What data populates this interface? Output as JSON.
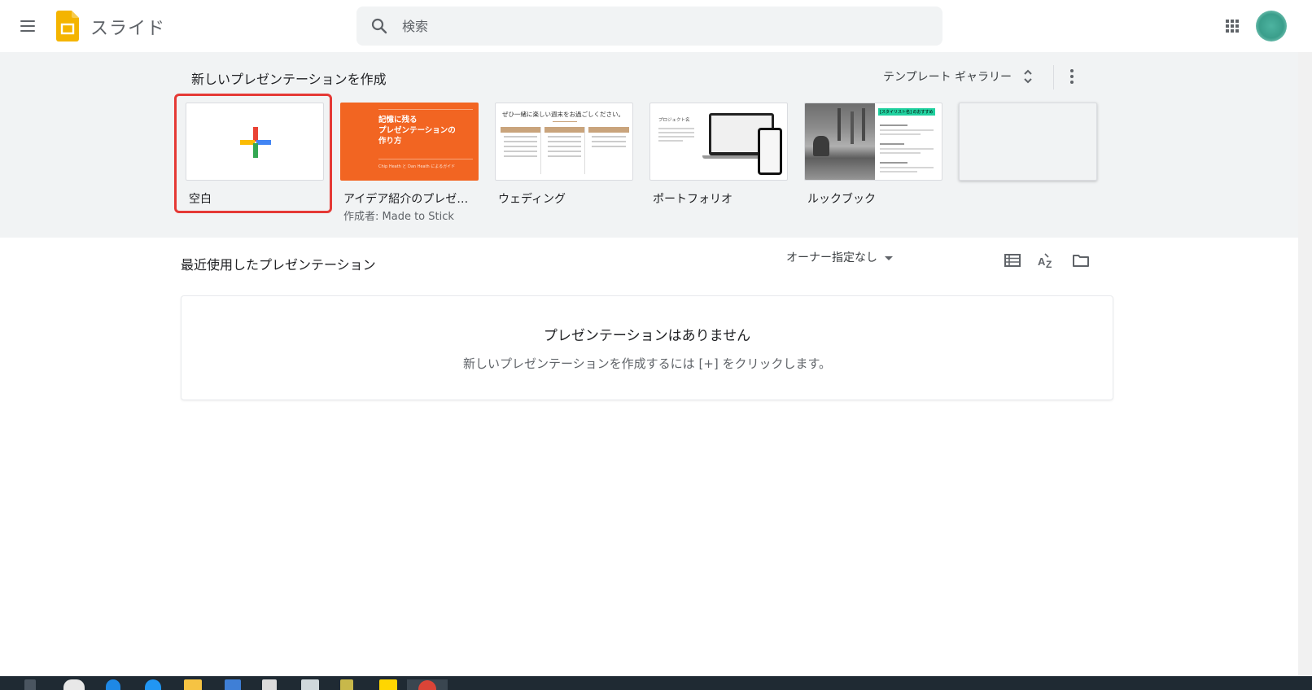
{
  "app": {
    "title": "スライド"
  },
  "search": {
    "placeholder": "検索"
  },
  "templates": {
    "heading": "新しいプレゼンテーションを作成",
    "gallery_label": "テンプレート ギャラリー",
    "items": [
      {
        "name": "空白",
        "author": ""
      },
      {
        "name": "アイデア紹介のプレゼ…",
        "author": "作成者: Made to Stick"
      },
      {
        "name": "ウェディング",
        "author": ""
      },
      {
        "name": "ポートフォリオ",
        "author": ""
      },
      {
        "name": "ルックブック",
        "author": ""
      },
      {
        "name": "",
        "author": ""
      }
    ],
    "thumbs": {
      "idea_title": "記憶に残る\nプレゼンテーションの\n作り方",
      "idea_sub": "Chip Heath と Dan Heath によるガイド",
      "wedding_heading": "ぜひ一緒に楽しい週末をお過ごしください。",
      "portfolio_label": "プロジェクト名",
      "lookbook_tag": "[スタイリスト名] のおすすめ"
    }
  },
  "recent": {
    "heading": "最近使用したプレゼンテーション",
    "owner_filter": "オーナー指定なし",
    "empty_title": "プレゼンテーションはありません",
    "empty_subtitle": "新しいプレゼンテーションを作成するには [+] をクリックします。"
  },
  "colors": {
    "slides_yellow": "#f4b400",
    "band_bg": "#f1f3f4",
    "highlight": "#e53935",
    "idea_orange": "#f26522"
  }
}
